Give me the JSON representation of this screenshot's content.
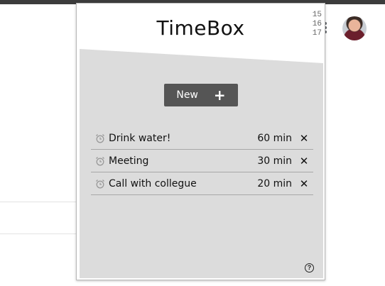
{
  "app": {
    "title": "TimeBox",
    "clock_digits": [
      "15",
      "16",
      "17"
    ]
  },
  "toolbar": {
    "new_label": "New",
    "new_icon": "plus-icon"
  },
  "timers": [
    {
      "name": "Drink water!",
      "duration": "60 min"
    },
    {
      "name": "Meeting",
      "duration": "30 min"
    },
    {
      "name": "Call with collegue",
      "duration": "20 min"
    }
  ],
  "icons": {
    "alarm": "alarm-clock-icon",
    "delete": "close-icon",
    "help": "help-icon",
    "help_glyph": "?",
    "delete_glyph": "✕"
  },
  "colors": {
    "panel_bg": "#dcdcdc",
    "button_bg": "#555555",
    "alarm_icon": "#9a9a9a"
  }
}
